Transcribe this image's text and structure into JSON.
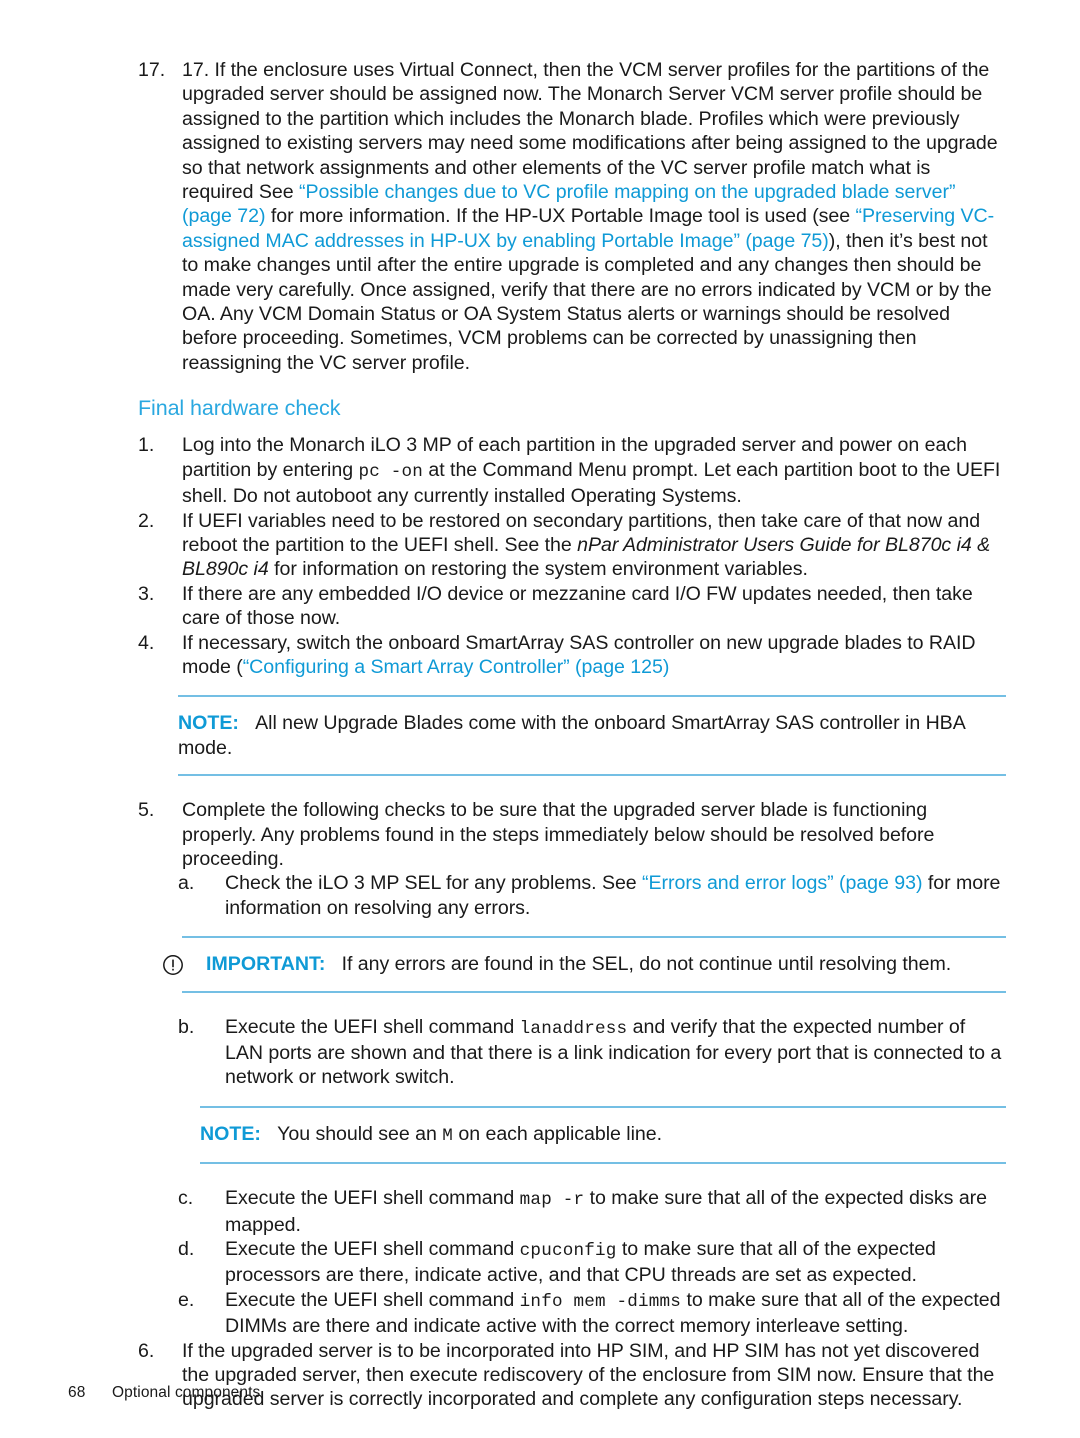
{
  "page": {
    "footer_page_number": "68",
    "footer_chapter": "Optional components"
  },
  "colors": {
    "link_blue": "#0f9ad6",
    "heading_blue": "#2aa8e0",
    "rule_blue": "#74bfe4",
    "body_text": "#1a1a1a"
  },
  "step17": {
    "marker": "17.",
    "t1": "17. If the enclosure uses Virtual Connect, then the VCM server profiles for the partitions of the upgraded server should be assigned now. The Monarch Server VCM server profile should be assigned to the partition which includes the Monarch blade. Profiles which were previously assigned to existing servers may need some modifications after being assigned to the upgrade so that network assignments and other elements of the VC server profile match what is required See ",
    "link1": "“Possible changes due to VC profile mapping on the upgraded blade server” (page 72)",
    "t2": " for more information. If the HP-UX Portable Image tool is used (see ",
    "link2": "“Preserving VC-assigned MAC addresses in HP-UX by enabling Portable Image” (page 75)",
    "t3": "), then it’s best not to make changes until after the entire upgrade is completed and any changes then should be made very carefully. Once assigned, verify that there are no errors indicated by VCM or by the OA. Any VCM Domain Status or OA System Status alerts or warnings should be resolved before proceeding. Sometimes, VCM problems can be corrected by unassigning then reassigning the VC server profile."
  },
  "section": {
    "heading": "Final hardware check"
  },
  "steps": [
    {
      "marker": "1.",
      "t1": "Log into the Monarch iLO 3 MP of each partition in the upgraded server and power on each partition by entering ",
      "cmd": "pc -on",
      "t2": " at the Command Menu prompt. Let each partition boot to the UEFI shell. Do not autoboot any currently installed Operating Systems."
    },
    {
      "marker": "2.",
      "t1": "If UEFI variables need to be restored on secondary partitions, then take care of that now and reboot the partition to the UEFI shell. See the ",
      "ital": "nPar Administrator Users Guide for BL870c i4 & BL890c i4",
      "t2": " for information on restoring the system environment variables."
    },
    {
      "marker": "3.",
      "t1": "If there are any embedded I/O device or mezzanine card I/O FW updates needed, then take care of those now."
    },
    {
      "marker": "4.",
      "t1": "If necessary, switch the onboard SmartArray SAS controller on new upgrade blades to RAID mode (",
      "link": "“Configuring a Smart Array Controller” (page 125)"
    }
  ],
  "note1": {
    "label": "NOTE:",
    "text": "All new Upgrade Blades come with the onboard SmartArray SAS controller in HBA mode."
  },
  "step5": {
    "marker": "5.",
    "text": "Complete the following checks to be sure that the upgraded server blade is functioning properly. Any problems found in the steps immediately below should be resolved before proceeding."
  },
  "substeps": [
    {
      "marker": "a.",
      "t1": "Check the iLO 3 MP SEL for any problems. See ",
      "link": "“Errors and error logs” (page 93)",
      "t2": " for more information on resolving any errors."
    },
    {
      "marker": "b.",
      "t1": "Execute the UEFI shell command ",
      "cmd": "lanaddress",
      "t2": " and verify that the expected number of LAN ports are shown and that there is a link indication for every port that is connected to a network or network switch."
    },
    {
      "marker": "c.",
      "t1": "Execute the UEFI shell command ",
      "cmd": "map -r",
      "t2": " to make sure that all of the expected disks are mapped."
    },
    {
      "marker": "d.",
      "t1": "Execute the UEFI shell command ",
      "cmd": "cpuconfig",
      "t2": " to make sure that all of the expected processors are there, indicate active, and that CPU threads are set as expected."
    },
    {
      "marker": "e.",
      "t1": "Execute the UEFI shell command ",
      "cmd": "info mem -dimms",
      "t2": " to make sure that all of the expected DIMMs are there and indicate active with the correct memory interleave setting."
    }
  ],
  "important": {
    "icon": "exclamation-circle-icon",
    "label": "IMPORTANT:",
    "text": "If any errors are found in the SEL, do not continue until resolving them."
  },
  "note2": {
    "label": "NOTE:",
    "t1": "You should see an ",
    "cmd": "M",
    "t2": " on each applicable line."
  },
  "step6": {
    "marker": "6.",
    "text": "If the upgraded server is to be incorporated into HP SIM, and HP SIM has not yet discovered the upgraded server, then execute rediscovery of the enclosure from SIM now. Ensure that the upgraded server is correctly incorporated and complete any configuration steps necessary."
  }
}
